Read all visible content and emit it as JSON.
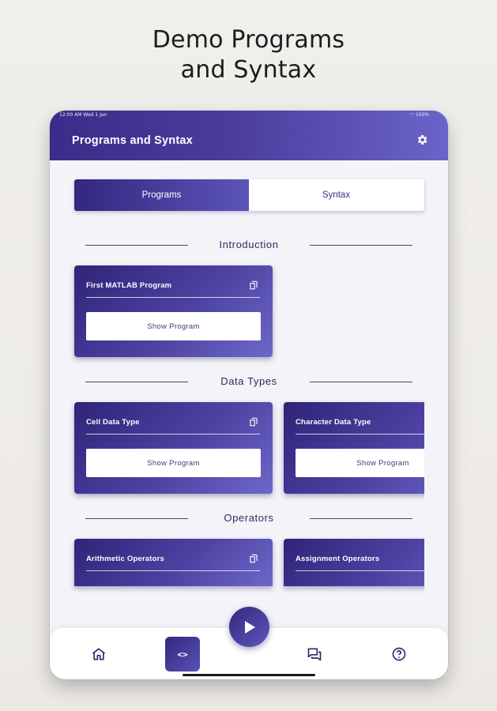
{
  "promo": {
    "title_line1": "Demo Programs",
    "title_line2": "and Syntax"
  },
  "statusbar": {
    "time": "12:00 AM   Wed 1 Jan",
    "battery": "100%"
  },
  "appbar": {
    "title": "Programs and Syntax",
    "settings_icon": "gear-icon"
  },
  "segmented": {
    "selected": "Programs",
    "options": [
      "Programs",
      "Syntax"
    ]
  },
  "sections": [
    {
      "title": "Introduction",
      "cards": [
        {
          "title": "First MATLAB Program",
          "button": "Show Program"
        }
      ]
    },
    {
      "title": "Data Types",
      "cards": [
        {
          "title": "Cell Data Type",
          "button": "Show Program"
        },
        {
          "title": "Character Data Type",
          "button": "Show Program"
        }
      ]
    },
    {
      "title": "Operators",
      "cards": [
        {
          "title": "Arithmetic Operators"
        },
        {
          "title": "Assignment Operators"
        }
      ]
    }
  ],
  "bottom_nav": {
    "items": [
      "home-icon",
      "code-icon",
      "chat-icon",
      "help-icon"
    ],
    "active": "code-icon",
    "code_glyph": "<>",
    "fab_icon": "play-icon"
  },
  "colors": {
    "primary_dark": "#33277f",
    "primary_light": "#6b64c8",
    "background": "#f3f3f8"
  }
}
